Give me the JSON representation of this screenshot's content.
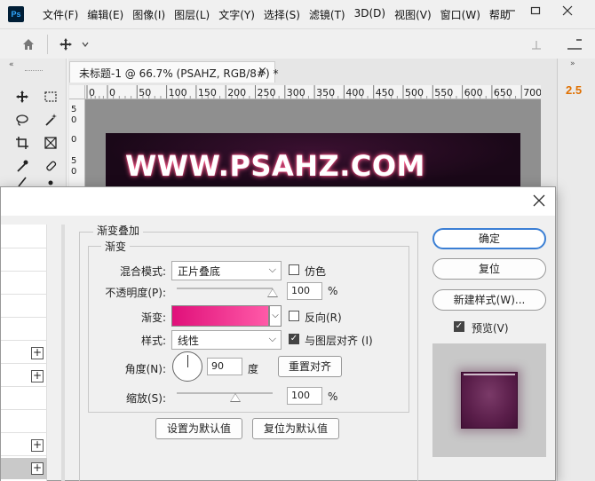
{
  "app": {
    "logo": "Ps",
    "menu": [
      "文件(F)",
      "编辑(E)",
      "图像(I)",
      "图层(L)",
      "文字(Y)",
      "选择(S)",
      "滤镜(T)",
      "3D(D)",
      "视图(V)",
      "窗口(W)",
      "帮助"
    ]
  },
  "right_panel": {
    "value": "2.5"
  },
  "document": {
    "tab_title": "未标题-1 @ 66.7% (PSAHZ, RGB/8#) *",
    "ruler_ticks": [
      "0",
      "0",
      "50",
      "100",
      "150",
      "200",
      "250",
      "300",
      "350",
      "400",
      "450",
      "500",
      "550",
      "600",
      "650",
      "700"
    ],
    "ruler_v": [
      "5",
      "0",
      "0",
      "5",
      "0"
    ],
    "canvas_text": "WWW.PSAHZ.COM"
  },
  "dialog": {
    "section_title": "渐变叠加",
    "group_title": "渐变",
    "blend_mode_label": "混合模式:",
    "blend_mode_value": "正片叠底",
    "dither_label": "仿色",
    "opacity_label": "不透明度(P):",
    "opacity_value": "100",
    "opacity_unit": "%",
    "gradient_label": "渐变:",
    "reverse_label": "反向(R)",
    "style_label": "样式:",
    "style_value": "线性",
    "align_label": "与图层对齐 (I)",
    "angle_label": "角度(N):",
    "angle_value": "90",
    "angle_unit": "度",
    "reset_align_label": "重置对齐",
    "scale_label": "缩放(S):",
    "scale_value": "100",
    "scale_unit": "%",
    "set_default_label": "设置为默认值",
    "reset_default_label": "复位为默认值",
    "ok_label": "确定",
    "reset_label": "复位",
    "new_style_label": "新建样式(W)...",
    "preview_label": "预览(V)",
    "dither_checked": false,
    "reverse_checked": false,
    "align_checked": true,
    "preview_checked": true,
    "gradient_colors": [
      "#e0107a",
      "#ff5aa8"
    ]
  }
}
